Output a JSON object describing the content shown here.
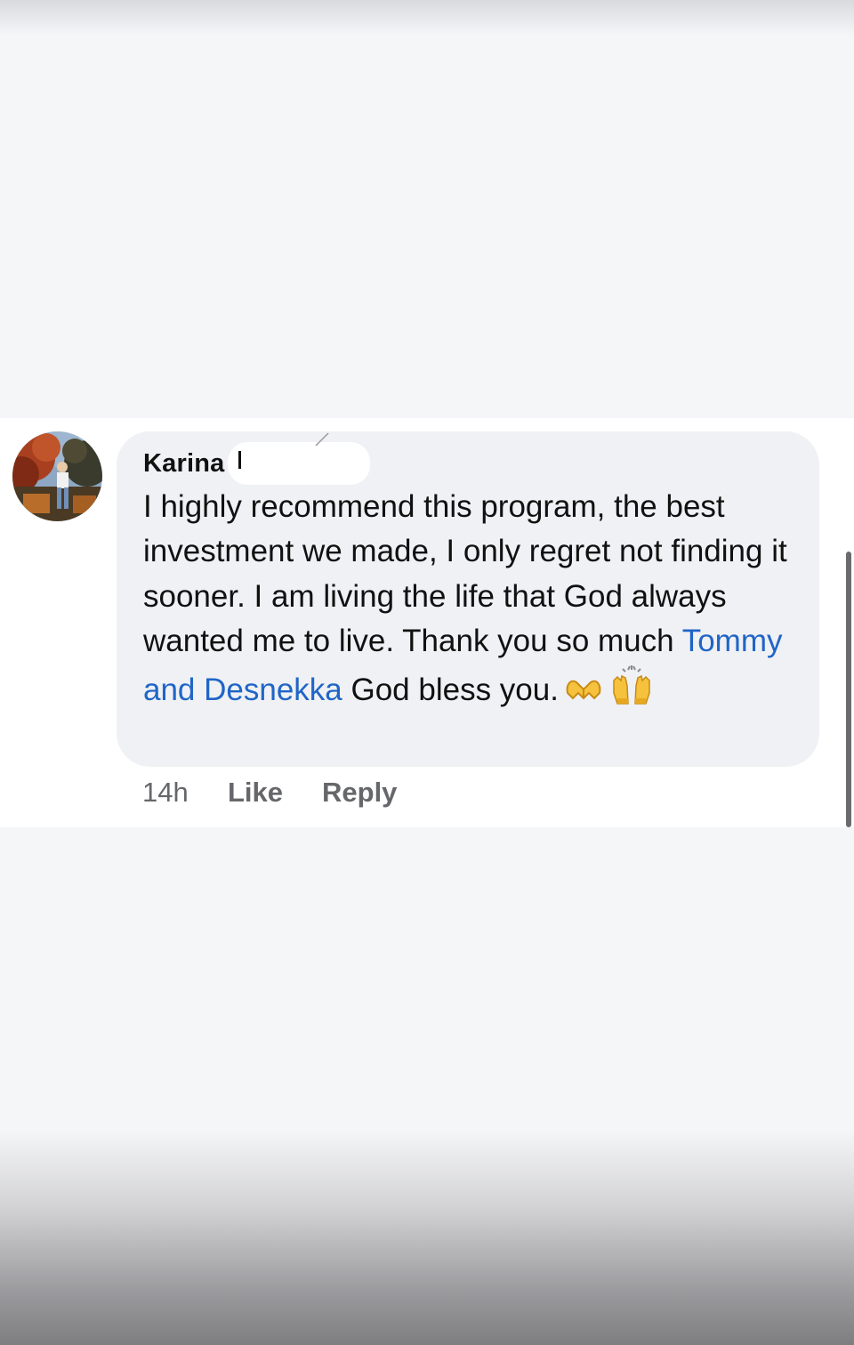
{
  "comment": {
    "author_name": "Karina",
    "text_before_mention": "I highly recommend this program, the best investment we made, I only regret not finding it sooner. I am living the life that God always wanted me to live. Thank you so much ",
    "mention": "Tommy and Desnekka",
    "text_after_mention": " God bless you.",
    "emojis": [
      "heart-hands-icon",
      "raising-hands-icon"
    ],
    "timestamp": "14h",
    "like_label": "Like",
    "reply_label": "Reply"
  },
  "colors": {
    "mention": "#2065c7",
    "bubble": "#eff1f4",
    "meta_text": "#65676b",
    "page_background": "#f5f6f8"
  }
}
